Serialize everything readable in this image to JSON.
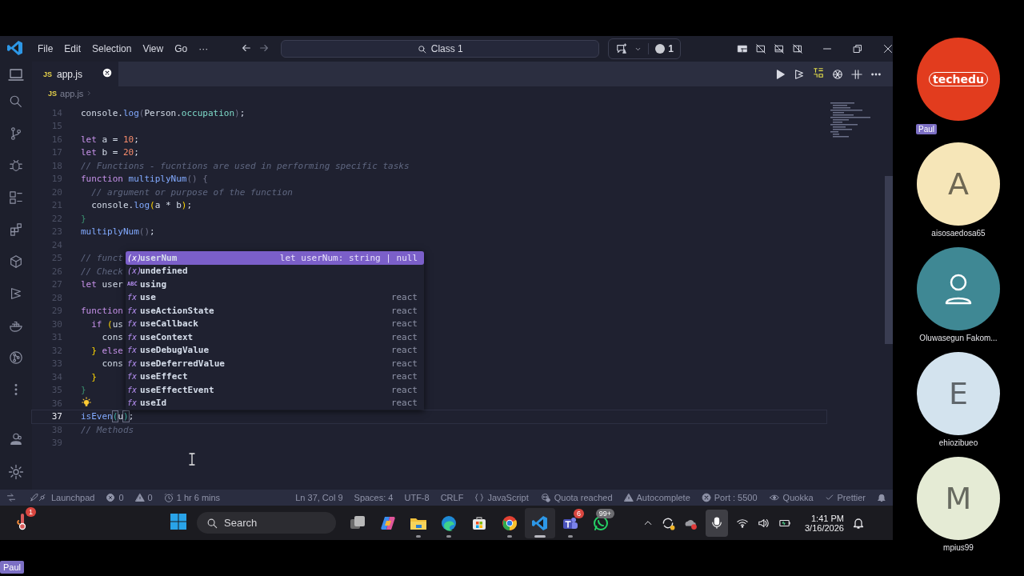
{
  "menu": [
    "File",
    "Edit",
    "Selection",
    "View",
    "Go",
    "···"
  ],
  "command_center": {
    "text": "Class 1"
  },
  "accounts": {
    "count": "1"
  },
  "tabs": [
    {
      "badge": "JS",
      "label": "app.js",
      "selected": true
    }
  ],
  "breadcrumb": {
    "badge": "JS",
    "file": "app.js"
  },
  "editor": {
    "lines": [
      {
        "number": "14",
        "current": false,
        "lightbulb": false,
        "tokens": [
          {
            "kind": "plain",
            "text": "console."
          },
          {
            "kind": "fn",
            "text": "log"
          },
          {
            "kind": "paren",
            "text": "("
          },
          {
            "kind": "plain",
            "text": "Person."
          },
          {
            "kind": "prop",
            "text": "occupation"
          },
          {
            "kind": "paren",
            "text": ")"
          },
          {
            "kind": "plain",
            "text": ";"
          }
        ]
      },
      {
        "number": "15",
        "current": false,
        "lightbulb": false
      },
      {
        "number": "16",
        "current": false,
        "lightbulb": false,
        "tokens": [
          {
            "kind": "kw",
            "text": "let"
          },
          {
            "kind": "plain",
            "text": " a = "
          },
          {
            "kind": "num",
            "text": "10"
          },
          {
            "kind": "plain",
            "text": ";"
          }
        ]
      },
      {
        "number": "17",
        "current": false,
        "lightbulb": false,
        "tokens": [
          {
            "kind": "kw",
            "text": "let"
          },
          {
            "kind": "plain",
            "text": " b = "
          },
          {
            "kind": "num",
            "text": "20"
          },
          {
            "kind": "plain",
            "text": ";"
          }
        ]
      },
      {
        "number": "18",
        "current": false,
        "lightbulb": false,
        "tokens": [
          {
            "kind": "cmt",
            "text": "// Functions - fucntions are used in performing specific tasks"
          }
        ]
      },
      {
        "number": "19",
        "current": false,
        "lightbulb": false,
        "tokens": [
          {
            "kind": "kw",
            "text": "function"
          },
          {
            "kind": "fn",
            "text": " multiplyNum"
          },
          {
            "kind": "paren",
            "text": "() {"
          }
        ]
      },
      {
        "number": "20",
        "current": false,
        "lightbulb": false,
        "tokens": [
          {
            "kind": "cmt",
            "text": "  // argument or purpose of the function"
          }
        ]
      },
      {
        "number": "21",
        "current": false,
        "lightbulb": false,
        "tokens": [
          {
            "kind": "plain",
            "text": "  console."
          },
          {
            "kind": "fn",
            "text": "log"
          },
          {
            "kind": "brace",
            "text": "("
          },
          {
            "kind": "plain",
            "text": "a * b"
          },
          {
            "kind": "brace",
            "text": ")"
          },
          {
            "kind": "plain",
            "text": ";"
          }
        ]
      },
      {
        "number": "22",
        "current": false,
        "lightbulb": false,
        "tokens": [
          {
            "kind": "green",
            "text": "}"
          }
        ]
      },
      {
        "number": "23",
        "current": false,
        "lightbulb": false,
        "tokens": [
          {
            "kind": "fn",
            "text": "multiplyNum"
          },
          {
            "kind": "paren",
            "text": "()"
          },
          {
            "kind": "plain",
            "text": ";"
          }
        ]
      },
      {
        "number": "24",
        "current": false,
        "lightbulb": false
      },
      {
        "number": "25",
        "current": false,
        "lightbulb": false,
        "tokens": [
          {
            "kind": "cmt",
            "text": "// funct"
          }
        ]
      },
      {
        "number": "26",
        "current": false,
        "lightbulb": false,
        "tokens": [
          {
            "kind": "cmt",
            "text": "// Check"
          }
        ]
      },
      {
        "number": "27",
        "current": false,
        "lightbulb": false,
        "tokens": [
          {
            "kind": "kw",
            "text": "let"
          },
          {
            "kind": "plain",
            "text": " user"
          }
        ]
      },
      {
        "number": "28",
        "current": false,
        "lightbulb": false
      },
      {
        "number": "29",
        "current": false,
        "lightbulb": false,
        "tokens": [
          {
            "kind": "kw",
            "text": "function"
          }
        ]
      },
      {
        "number": "30",
        "current": false,
        "lightbulb": false,
        "tokens": [
          {
            "kind": "kw",
            "text": "  if"
          },
          {
            "kind": "brace",
            "text": " ("
          },
          {
            "kind": "plain",
            "text": "us"
          }
        ]
      },
      {
        "number": "31",
        "current": false,
        "lightbulb": false,
        "tokens": [
          {
            "kind": "plain",
            "text": "    cons"
          }
        ]
      },
      {
        "number": "32",
        "current": false,
        "lightbulb": false,
        "tokens": [
          {
            "kind": "brace",
            "text": "  }"
          },
          {
            "kind": "kw",
            "text": " else"
          }
        ]
      },
      {
        "number": "33",
        "current": false,
        "lightbulb": false,
        "tokens": [
          {
            "kind": "plain",
            "text": "    cons"
          }
        ]
      },
      {
        "number": "34",
        "current": false,
        "lightbulb": false,
        "tokens": [
          {
            "kind": "brace",
            "text": "  }"
          }
        ]
      },
      {
        "number": "35",
        "current": false,
        "lightbulb": false,
        "tokens": [
          {
            "kind": "green",
            "text": "}"
          }
        ]
      },
      {
        "number": "36",
        "current": false,
        "lightbulb": true
      },
      {
        "number": "37",
        "current": true,
        "lightbulb": false,
        "tokens": [
          {
            "kind": "fn",
            "text": "isEven"
          },
          {
            "kind": "match",
            "text": "("
          },
          {
            "kind": "plain",
            "text": "u"
          },
          {
            "kind": "match",
            "text": ")"
          },
          {
            "kind": "plain",
            "text": ";"
          }
        ]
      },
      {
        "number": "38",
        "current": false,
        "lightbulb": false,
        "tokens": [
          {
            "kind": "cmt",
            "text": "// Methods"
          }
        ]
      },
      {
        "number": "39",
        "current": false,
        "lightbulb": false
      }
    ]
  },
  "suggestions": [
    {
      "symbol": "(x)",
      "label": "userNum",
      "detail": "let userNum: string | null",
      "selected": true
    },
    {
      "symbol": "(x)",
      "label": "undefined",
      "selected": false
    },
    {
      "symbol": "ABC",
      "label": "using",
      "selected": false
    },
    {
      "symbol": "fx",
      "label": "use",
      "detail": "react",
      "selected": false
    },
    {
      "symbol": "fx",
      "label": "useActionState",
      "detail": "react",
      "selected": false
    },
    {
      "symbol": "fx",
      "label": "useCallback",
      "detail": "react",
      "selected": false
    },
    {
      "symbol": "fx",
      "label": "useContext",
      "detail": "react",
      "selected": false
    },
    {
      "symbol": "fx",
      "label": "useDebugValue",
      "detail": "react",
      "selected": false
    },
    {
      "symbol": "fx",
      "label": "useDeferredValue",
      "detail": "react",
      "selected": false
    },
    {
      "symbol": "fx",
      "label": "useEffect",
      "detail": "react",
      "selected": false
    },
    {
      "symbol": "fx",
      "label": "useEffectEvent",
      "detail": "react",
      "selected": false
    },
    {
      "symbol": "fx",
      "label": "useId",
      "detail": "react",
      "selected": false
    }
  ],
  "status_bar": {
    "left": [
      {
        "kind": "launchpad",
        "text": "Launchpad"
      },
      {
        "kind": "errors",
        "text": "0"
      },
      {
        "kind": "warnings",
        "text": "0"
      },
      {
        "kind": "timer",
        "text": "1 hr 6 mins"
      }
    ],
    "right": [
      {
        "kind": "plain",
        "text": "Ln 37, Col 9"
      },
      {
        "kind": "plain",
        "text": "Spaces: 4"
      },
      {
        "kind": "plain",
        "text": "UTF-8"
      },
      {
        "kind": "plain",
        "text": "CRLF"
      },
      {
        "kind": "braces",
        "text": "JavaScript"
      },
      {
        "kind": "quota",
        "text": "Quota reached"
      },
      {
        "kind": "warning",
        "text": "Autocomplete"
      },
      {
        "kind": "port",
        "text": "Port : 5500"
      },
      {
        "kind": "eye",
        "text": "Quokka"
      },
      {
        "kind": "check",
        "text": "Prettier"
      }
    ]
  },
  "taskbar": {
    "pinned_badge": "1",
    "search": {
      "placeholder": "Search"
    },
    "apps": [
      {
        "kind": "taskview",
        "running": false,
        "selected": false
      },
      {
        "kind": "copilot",
        "running": false,
        "selected": false
      },
      {
        "kind": "files",
        "running": true,
        "selected": false
      },
      {
        "kind": "edge",
        "running": true,
        "selected": false
      },
      {
        "kind": "store",
        "running": false,
        "selected": false
      },
      {
        "kind": "chrome",
        "running": true,
        "selected": false
      },
      {
        "kind": "vscode",
        "running": true,
        "selected": true
      },
      {
        "kind": "teams",
        "running": true,
        "selected": false,
        "badge": "6"
      },
      {
        "kind": "whatsapp",
        "running": false,
        "selected": false,
        "badge": "99+"
      }
    ],
    "mic_on": true,
    "time": "1:41 PM",
    "date": "3/16/2026"
  },
  "participants": [
    {
      "kind": "logo",
      "logo_text": "techedu",
      "name": "Paul",
      "presenting": true,
      "color": "#e23c1e"
    },
    {
      "kind": "letter",
      "initial": "A",
      "name": "aisosaedosa65",
      "presenting": false,
      "color": "#f6e6b8"
    },
    {
      "kind": "icon",
      "name": "Oluwasegun Fakom...",
      "presenting": false,
      "color": "#3f8894"
    },
    {
      "kind": "letter",
      "initial": "E",
      "name": "ehiozibueo",
      "presenting": false,
      "color": "#d3e3ee"
    },
    {
      "kind": "letter",
      "initial": "M",
      "name": "mpius99",
      "presenting": false,
      "color": "#e5ebd5"
    }
  ],
  "presenter_tag": "Paul"
}
